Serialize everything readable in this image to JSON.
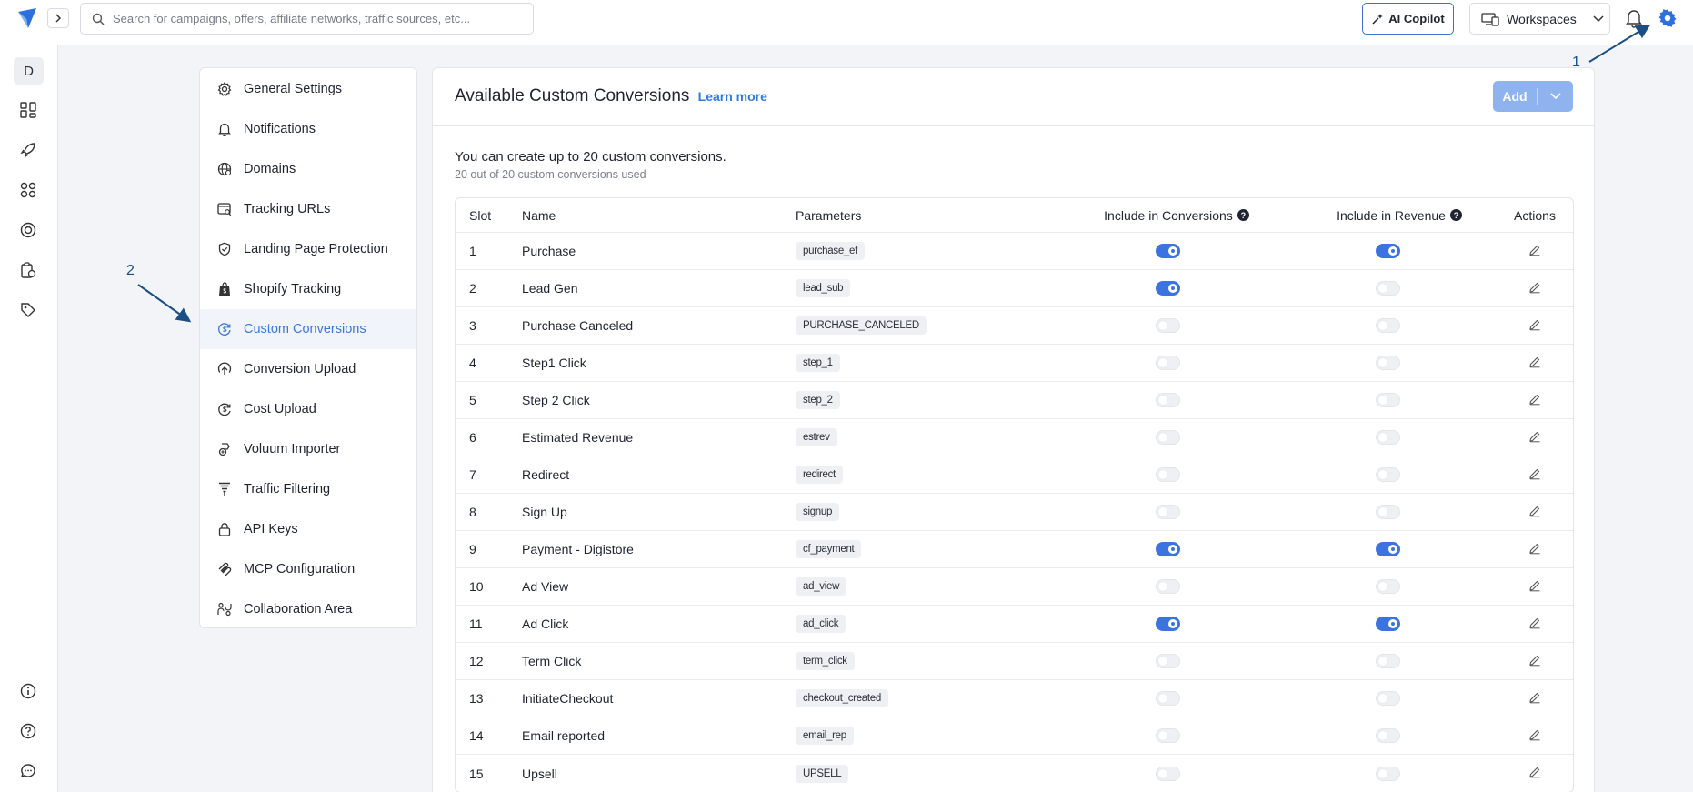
{
  "search": {
    "placeholder": "Search for campaigns, offers, affiliate networks, traffic sources, etc..."
  },
  "header": {
    "ai_copilot_label": "AI Copilot",
    "workspaces_label": "Workspaces"
  },
  "rail": {
    "avatar_letter": "D"
  },
  "annotations": {
    "arrow1_label": "1",
    "arrow2_label": "2"
  },
  "settings_nav": {
    "items": [
      {
        "label": "General Settings",
        "icon": "gear-icon"
      },
      {
        "label": "Notifications",
        "icon": "bell-icon"
      },
      {
        "label": "Domains",
        "icon": "globe-icon"
      },
      {
        "label": "Tracking URLs",
        "icon": "browser-search-icon"
      },
      {
        "label": "Landing Page Protection",
        "icon": "shield-check-icon"
      },
      {
        "label": "Shopify Tracking",
        "icon": "shopify-bag-icon"
      },
      {
        "label": "Custom Conversions",
        "icon": "dollar-cycle-icon",
        "active": true
      },
      {
        "label": "Conversion Upload",
        "icon": "upload-circle-icon"
      },
      {
        "label": "Cost Upload",
        "icon": "dollar-upload-icon"
      },
      {
        "label": "Voluum Importer",
        "icon": "import-icon"
      },
      {
        "label": "Traffic Filtering",
        "icon": "funnel-icon"
      },
      {
        "label": "API Keys",
        "icon": "lock-icon"
      },
      {
        "label": "MCP Configuration",
        "icon": "mcp-icon"
      },
      {
        "label": "Collaboration Area",
        "icon": "people-icon"
      }
    ]
  },
  "main": {
    "title": "Available Custom Conversions",
    "learn_more": "Learn more",
    "add_label": "Add",
    "limit_text": "You can create up to 20 custom conversions.",
    "used_text": "20 out of 20 custom conversions used",
    "columns": {
      "slot": "Slot",
      "name": "Name",
      "parameters": "Parameters",
      "include_conversions": "Include in Conversions",
      "include_revenue": "Include in Revenue",
      "actions": "Actions"
    },
    "rows": [
      {
        "slot": "1",
        "name": "Purchase",
        "param": "purchase_ef",
        "conv": true,
        "rev": true
      },
      {
        "slot": "2",
        "name": "Lead Gen",
        "param": "lead_sub",
        "conv": true,
        "rev": false
      },
      {
        "slot": "3",
        "name": "Purchase Canceled",
        "param": "PURCHASE_CANCELED",
        "conv": false,
        "rev": false
      },
      {
        "slot": "4",
        "name": "Step1 Click",
        "param": "step_1",
        "conv": false,
        "rev": false
      },
      {
        "slot": "5",
        "name": "Step 2 Click",
        "param": "step_2",
        "conv": false,
        "rev": false
      },
      {
        "slot": "6",
        "name": "Estimated Revenue",
        "param": "estrev",
        "conv": false,
        "rev": false
      },
      {
        "slot": "7",
        "name": "Redirect",
        "param": "redirect",
        "conv": false,
        "rev": false
      },
      {
        "slot": "8",
        "name": "Sign Up",
        "param": "signup",
        "conv": false,
        "rev": false
      },
      {
        "slot": "9",
        "name": "Payment - Digistore",
        "param": "cf_payment",
        "conv": true,
        "rev": true
      },
      {
        "slot": "10",
        "name": "Ad View",
        "param": "ad_view",
        "conv": false,
        "rev": false
      },
      {
        "slot": "11",
        "name": "Ad Click",
        "param": "ad_click",
        "conv": true,
        "rev": true
      },
      {
        "slot": "12",
        "name": "Term Click",
        "param": "term_click",
        "conv": false,
        "rev": false
      },
      {
        "slot": "13",
        "name": "InitiateCheckout",
        "param": "checkout_created",
        "conv": false,
        "rev": false
      },
      {
        "slot": "14",
        "name": "Email reported",
        "param": "email_rep",
        "conv": false,
        "rev": false
      },
      {
        "slot": "15",
        "name": "Upsell",
        "param": "UPSELL",
        "conv": false,
        "rev": false
      }
    ]
  },
  "colors": {
    "accent": "#3b74e0",
    "active_nav_text": "#3b78d8",
    "annotation": "#1a4f86"
  }
}
